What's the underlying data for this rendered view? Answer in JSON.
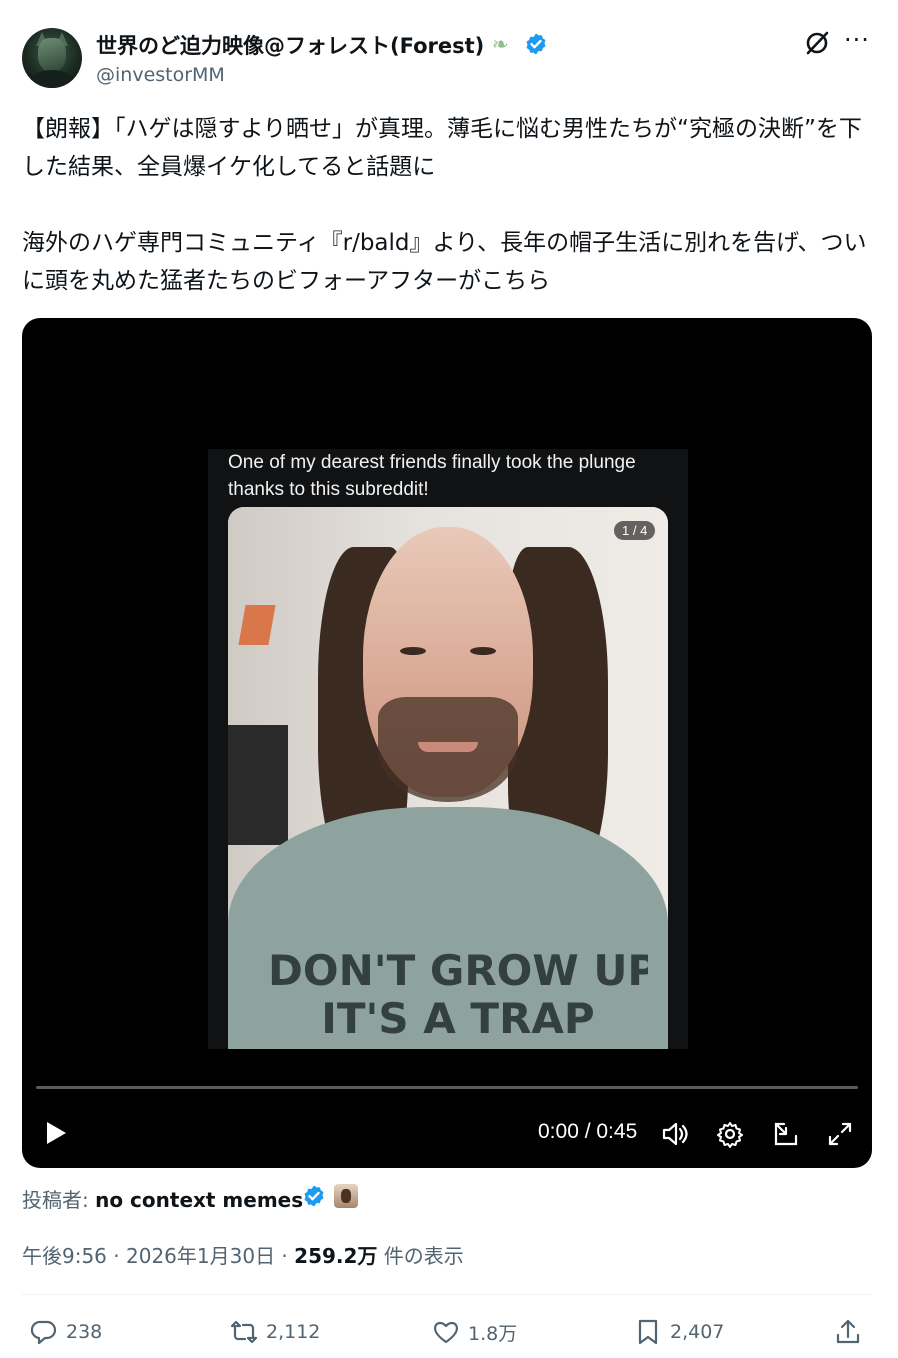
{
  "author": {
    "display_name": "世界のど迫力映像@フォレスト(Forest)",
    "handle": "@investorMM",
    "name_icon": "leaf-icon",
    "verified": true
  },
  "header_icons": [
    "grok-icon",
    "more-icon"
  ],
  "tweet": {
    "paragraph_1": "【朗報】「ハゲは隠すより晒せ」が真理。薄毛に悩む男性たちが“究極の決断”を下した結果、全員爆イケ化してると話題に",
    "paragraph_2": "海外のハゲ専門コミュニティ『r/bald』より、長年の帽子生活に別れを告げ、ついに頭を丸めた猛者たちのビフォーアフターがこちら"
  },
  "video": {
    "caption": "One of my dearest friends finally took the plunge thanks to this subreddit!",
    "photo_counter": "1 / 4",
    "shirt_line_1": "DON'T GROW UP",
    "shirt_line_2": "IT'S A TRAP",
    "time": "0:00 / 0:45",
    "progress": 0.0,
    "controls": [
      "play-icon",
      "volume-icon",
      "settings-icon",
      "pip-icon",
      "fullscreen-icon"
    ]
  },
  "source": {
    "label": "投稿者: ",
    "author": "no context memes"
  },
  "meta": {
    "time": "午後9:56",
    "sep1": " · ",
    "date": "2026年1月30日",
    "sep2": " · ",
    "views": "259.2万",
    "views_suffix": " 件の表示"
  },
  "actions": {
    "replies": "238",
    "reposts": "2,112",
    "likes": "1.8万",
    "bookmarks": "2,407"
  },
  "colors": {
    "verified_blue": "#1d9bf0",
    "text_primary": "#0f1419",
    "text_secondary": "#536471"
  }
}
